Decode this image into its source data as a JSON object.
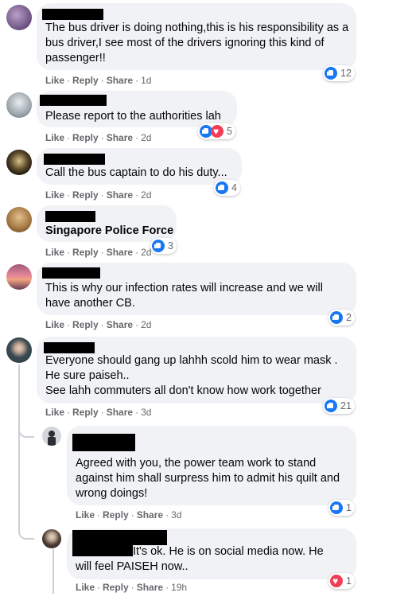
{
  "comments": [
    {
      "text": "The bus driver is doing nothing,this is his responsibility as a bus driver,I see most of the drivers ignoring this kind of passenger!!",
      "actions": {
        "like": "Like",
        "reply": "Reply",
        "share": "Share",
        "age": "1d"
      },
      "reactions": {
        "icons": [
          "like"
        ],
        "count": "12"
      }
    },
    {
      "text": "Please report to the authorities lah",
      "actions": {
        "like": "Like",
        "reply": "Reply",
        "share": "Share",
        "age": "2d"
      },
      "reactions": {
        "icons": [
          "like",
          "love"
        ],
        "count": "5"
      }
    },
    {
      "text": "Call the bus captain to do his duty...",
      "actions": {
        "like": "Like",
        "reply": "Reply",
        "share": "Share",
        "age": "2d"
      },
      "reactions": {
        "icons": [
          "like"
        ],
        "count": "4"
      }
    },
    {
      "text": "Singapore Police Force",
      "actions": {
        "like": "Like",
        "reply": "Reply",
        "share": "Share",
        "age": "2d"
      },
      "reactions": {
        "icons": [
          "like"
        ],
        "count": "3"
      }
    },
    {
      "text": "This is why our infection rates will increase and we will have another CB.",
      "actions": {
        "like": "Like",
        "reply": "Reply",
        "share": "Share",
        "age": "2d"
      },
      "reactions": {
        "icons": [
          "like"
        ],
        "count": "2"
      }
    },
    {
      "text": "Everyone should gang up lahhh scold him to wear mask .\nHe sure paiseh..\nSee lahh commuters all don't know how work together",
      "actions": {
        "like": "Like",
        "reply": "Reply",
        "share": "Share",
        "age": "3d"
      },
      "reactions": {
        "icons": [
          "like"
        ],
        "count": "21"
      }
    },
    {
      "text": "Agreed with you, the power team work to stand against him shall surpress him to admit his quilt and wrong doings!",
      "actions": {
        "like": "Like",
        "reply": "Reply",
        "share": "Share",
        "age": "3d"
      },
      "reactions": {
        "icons": [
          "like"
        ],
        "count": "1"
      }
    },
    {
      "text": "It's ok. He is on social media now. He will feel PAISEH now..",
      "actions": {
        "like": "Like",
        "reply": "Reply",
        "share": "Share",
        "age": "19h"
      },
      "reactions": {
        "icons": [
          "love"
        ],
        "count": "1"
      }
    }
  ],
  "colors": {
    "bubble": "#f0f2f5",
    "like": "#1877f2",
    "love": "#f33e58",
    "meta": "#65676b"
  }
}
